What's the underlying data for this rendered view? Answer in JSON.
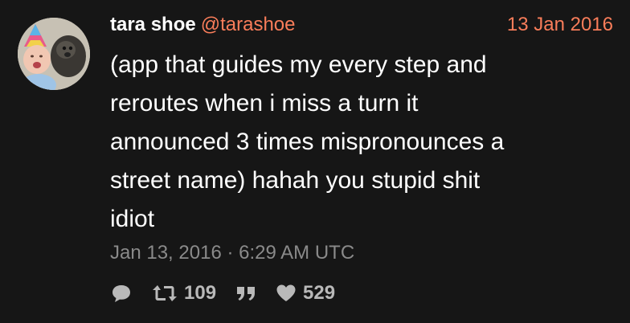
{
  "tweet": {
    "fullname": "tara shoe",
    "username": "@tarashoe",
    "date": "13 Jan 2016",
    "content": "(app that guides my every step and\nreroutes when i miss a turn it\nannounced 3 times mispronounces a\nstreet name) hahah you stupid shit\nidiot",
    "published": "Jan 13, 2016 · 6:29 AM UTC"
  },
  "stats": {
    "replies_icon": "comment-icon",
    "retweets_icon": "retweet-icon",
    "retweets": "109",
    "quotes_icon": "quote-icon",
    "likes_icon": "heart-icon",
    "likes": "529"
  },
  "colors": {
    "background": "#161616",
    "accent": "#f97d5a",
    "muted": "#8a8a8a",
    "stat": "#b9b9b9"
  }
}
